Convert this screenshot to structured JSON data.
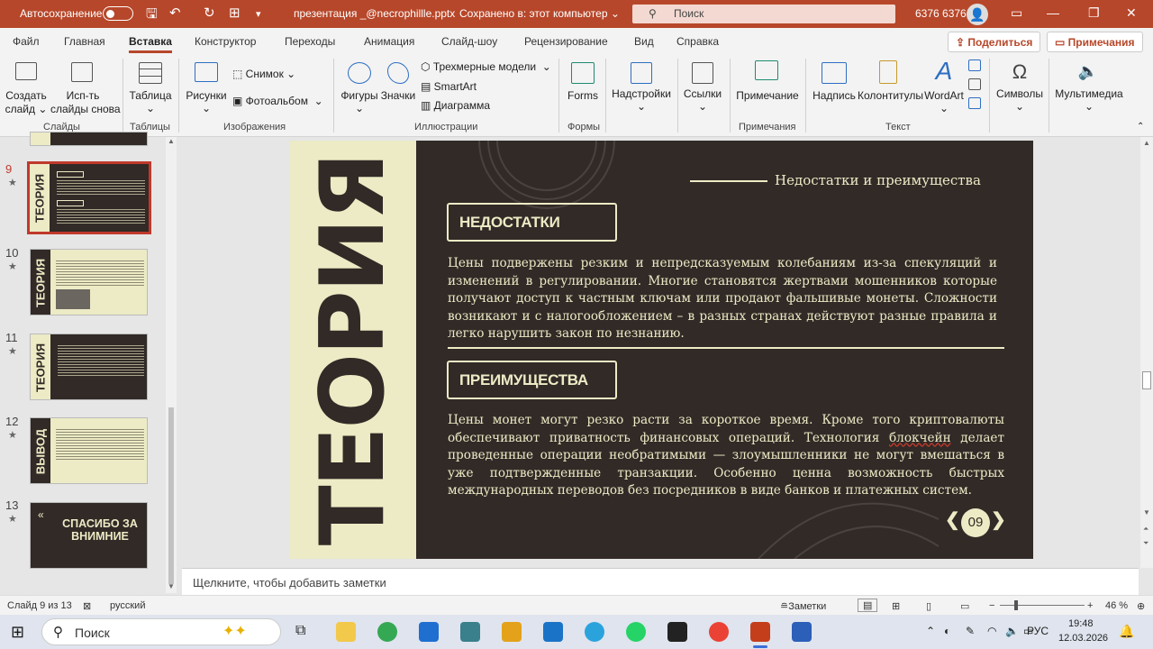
{
  "titlebar": {
    "autosave_label": "Автосохранение",
    "autosave_state": "off",
    "doc_title": "презентация _@necrophillle.pptx",
    "save_status": "Сохранено в: этот компьютер",
    "search_placeholder": "Поиск",
    "user_name": "6376 6376"
  },
  "tabs": [
    "Файл",
    "Главная",
    "Вставка",
    "Конструктор",
    "Переходы",
    "Анимация",
    "Слайд-шоу",
    "Рецензирование",
    "Вид",
    "Справка"
  ],
  "active_tab": "Вставка",
  "share_label": "Поделиться",
  "comments_label": "Примечания",
  "ribbon": {
    "new_slide": [
      "Создать",
      "слайд ⌄"
    ],
    "reuse_slides": [
      "Исп-ть",
      "слайды снова"
    ],
    "table": "Таблица",
    "pictures": "Рисунки",
    "screenshot": "Снимок ⌄",
    "photo_album": "Фотоальбом",
    "shapes": "Фигуры",
    "icons": "Значки",
    "models_3d": "Трехмерные модели",
    "smartart": "SmartArt",
    "chart": "Диаграмма",
    "forms": "Forms",
    "addins": "Надстройки",
    "links": "Ссылки",
    "comment": "Примечание",
    "textbox": "Надпись",
    "header_footer": "Колонтитулы",
    "wordart": "WordArt",
    "symbols": "Символы",
    "media": "Мультимедиа",
    "groups": [
      "Слайды",
      "Таблицы",
      "Изображения",
      "Иллюстрации",
      "Формы",
      "Примечания",
      "Текст"
    ]
  },
  "thumbnails": [
    {
      "num": "9",
      "word": "ТЕОРИЯ",
      "selected": true
    },
    {
      "num": "10",
      "word": "ТЕОРИЯ",
      "selected": false
    },
    {
      "num": "11",
      "word": "ТЕОРИЯ",
      "selected": false
    },
    {
      "num": "12",
      "word": "ВЫВОД",
      "selected": false
    },
    {
      "num": "13",
      "word": "СПАСИБО ЗА ВНИМНИЕ",
      "selected": false
    }
  ],
  "slide": {
    "side_word": "ТЕОРИЯ",
    "heading": "Недостатки и преимущества",
    "box1": "НЕДОСТАТКИ",
    "para1": "Цены подвержены резким и непредсказуемым колебаниям из-за спекуляций и изменений в регулировании. Многие становятся жертвами мошенников которые получают доступ к частным ключам или продают фальшивые монеты. Сложности возникают и с налогообложением – в разных странах действуют разные правила и легко нарушить закон по незнанию.",
    "box2": "ПРЕИМУЩЕСТВА",
    "para2_a": "Цены монет могут резко расти за короткое время. Кроме того криптовалюты обеспечивают приватность финансовых операций. Технология ",
    "para2_link": "блокчейн",
    "para2_b": " делает проведенные операции необратимыми — злоумышленники не могут вмешаться в уже подтвержденные транзакции. Особенно ценна возможность быстрых международных переводов без посредников в виде банков и платежных систем.",
    "page_num": "09"
  },
  "notes_placeholder": "Щелкните, чтобы добавить заметки",
  "status": {
    "slide_info": "Слайд 9 из 13",
    "language": "русский",
    "notes_btn": "Заметки",
    "zoom": "46 %"
  },
  "taskbar": {
    "search_label": "Поиск",
    "lang": "РУС",
    "time": "19:48",
    "date": "12.03.2026"
  },
  "colors": {
    "accent": "#b7472a",
    "slide_dark": "#312a27",
    "slide_cream": "#ecebc5"
  }
}
